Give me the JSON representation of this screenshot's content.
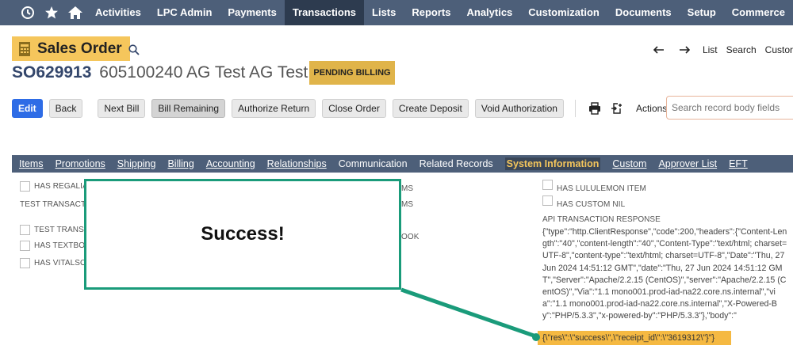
{
  "nav": {
    "items": [
      "Activities",
      "LPC Admin",
      "Payments",
      "Transactions",
      "Lists",
      "Reports",
      "Analytics",
      "Customization",
      "Documents",
      "Setup",
      "Commerce"
    ],
    "active": "Transactions",
    "icons": [
      "recent-history-icon",
      "star-icon",
      "home-icon"
    ]
  },
  "record": {
    "type_label": "Sales Order",
    "number": "SO629913",
    "name": "605100240 AG Test AG Test",
    "status": "PENDING BILLING"
  },
  "record_nav": {
    "list": "List",
    "search": "Search",
    "customize": "Custor"
  },
  "toolbar": {
    "edit": "Edit",
    "back": "Back",
    "next_bill": "Next Bill",
    "bill_remaining": "Bill Remaining",
    "authorize_return": "Authorize Return",
    "close_order": "Close Order",
    "create_deposit": "Create Deposit",
    "void_authorization": "Void Authorization",
    "actions": "Actions",
    "search_placeholder": "Search record body fields"
  },
  "subtabs": [
    "Items",
    "Promotions",
    "Shipping",
    "Billing",
    "Accounting",
    "Relationships",
    "Communication",
    "Related Records",
    "System Information",
    "Custom",
    "Approver List",
    "EFT"
  ],
  "active_subtab": "System Information",
  "fields": {
    "left": [
      "HAS REGALIA",
      "TEST TRANSACTION",
      "TEST TRANSA",
      "HAS TEXTBOO",
      "HAS VITALSO"
    ],
    "middle": [
      "MS",
      "MS",
      "OOK"
    ],
    "right": [
      "HAS LULULEMON ITEM",
      "HAS CUSTOM NIL"
    ]
  },
  "api_response": {
    "label": "API TRANSACTION RESPONSE",
    "body": "{\"type\":\"http.ClientResponse\",\"code\":200,\"headers\":{\"Content-Length\":\"40\",\"content-length\":\"40\",\"Content-Type\":\"text/html; charset=UTF-8\",\"content-type\":\"text/html; charset=UTF-8\",\"Date\":\"Thu, 27 Jun 2024 14:51:12 GMT\",\"date\":\"Thu, 27 Jun 2024 14:51:12 GMT\",\"Server\":\"Apache/2.2.15 (CentOS)\",\"server\":\"Apache/2.2.15 (CentOS)\",\"Via\":\"1.1 mono001.prod-iad-na22.core.ns.internal\",\"via\":\"1.1 mono001.prod-iad-na22.core.ns.internal\",\"X-Powered-By\":\"PHP/5.3.3\",\"x-powered-by\":\"PHP/5.3.3\"},\"body\":\"",
    "highlight": "{\\\"res\\\":\\\"success\\\",\\\"receipt_id\\\":\\\"3619312\\\"}\"}"
  },
  "callout": {
    "text": "Success!",
    "color": "#1a9b7a"
  },
  "colors": {
    "nav_bg": "#4d5f79",
    "nav_active": "#2d3b4f",
    "record_type_bg": "#f5c65c",
    "status_bg": "#e0b44a",
    "primary_button": "#2e6ce6",
    "highlight": "#f5b942"
  }
}
